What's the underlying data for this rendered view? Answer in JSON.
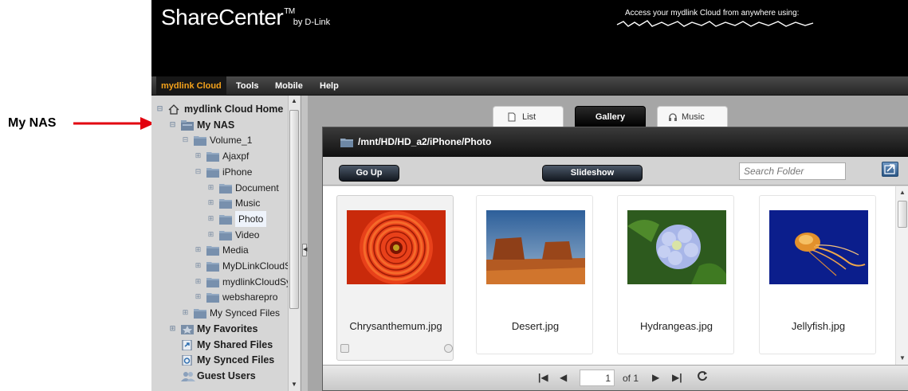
{
  "callout": {
    "label": "My NAS"
  },
  "header": {
    "logo": {
      "name": "ShareCenter",
      "tm": "TM",
      "by": "by D-Link"
    },
    "access_text": "Access your mydlink Cloud from anywhere using:"
  },
  "menu": [
    {
      "label": "mydlink Cloud",
      "active": true
    },
    {
      "label": "Tools",
      "active": false
    },
    {
      "label": "Mobile",
      "active": false
    },
    {
      "label": "Help",
      "active": false
    }
  ],
  "tree": [
    {
      "label": "mydlink Cloud Home",
      "icon": "home-icon",
      "expander": "minus"
    },
    {
      "label": "My NAS",
      "icon": "nas-icon",
      "expander": "minus"
    },
    {
      "label": "Volume_1",
      "icon": "folder-icon",
      "expander": "minus"
    },
    {
      "label": "Ajaxpf",
      "icon": "folder-icon",
      "expander": "plus"
    },
    {
      "label": "iPhone",
      "icon": "folder-icon",
      "expander": "minus"
    },
    {
      "label": "Document",
      "icon": "folder-icon",
      "expander": "plus"
    },
    {
      "label": "Music",
      "icon": "folder-icon",
      "expander": "plus"
    },
    {
      "label": "Photo",
      "icon": "folder-icon",
      "expander": "plus",
      "selected": true
    },
    {
      "label": "Video",
      "icon": "folder-icon",
      "expander": "plus"
    },
    {
      "label": "Media",
      "icon": "folder-icon",
      "expander": "plus"
    },
    {
      "label": "MyDLinkCloudSy",
      "icon": "folder-icon",
      "expander": "plus"
    },
    {
      "label": "mydlinkCloudSyı",
      "icon": "folder-icon",
      "expander": "plus"
    },
    {
      "label": "websharepro",
      "icon": "folder-icon",
      "expander": "plus"
    },
    {
      "label": "My Synced Files",
      "icon": "folder-icon",
      "expander": "plus"
    },
    {
      "label": "My Favorites",
      "icon": "favorites-icon",
      "expander": "plus"
    },
    {
      "label": "My Shared Files",
      "icon": "shared-files-icon",
      "expander": "none"
    },
    {
      "label": "My Synced Files",
      "icon": "synced-files-icon",
      "expander": "none"
    },
    {
      "label": "Guest Users",
      "icon": "guest-users-icon",
      "expander": "none"
    }
  ],
  "tabs": [
    {
      "label": "List",
      "icon": "list-icon",
      "active": false
    },
    {
      "label": "Gallery",
      "active": true
    },
    {
      "label": "Music",
      "icon": "headphones-icon",
      "active": false
    }
  ],
  "path": "/mnt/HD/HD_a2/iPhone/Photo",
  "toolbar": {
    "go_up": "Go Up",
    "slideshow": "Slideshow",
    "search_placeholder": "Search Folder"
  },
  "gallery": [
    {
      "filename": "Chrysanthemum.jpg",
      "selected": true
    },
    {
      "filename": "Desert.jpg"
    },
    {
      "filename": "Hydrangeas.jpg"
    },
    {
      "filename": "Jellyfish.jpg"
    }
  ],
  "pager": {
    "current": "1",
    "of_label": "of 1"
  },
  "colors": {
    "accent": "#f4a21b",
    "callout_red": "#e2000f",
    "selection": "#eef3fb"
  }
}
